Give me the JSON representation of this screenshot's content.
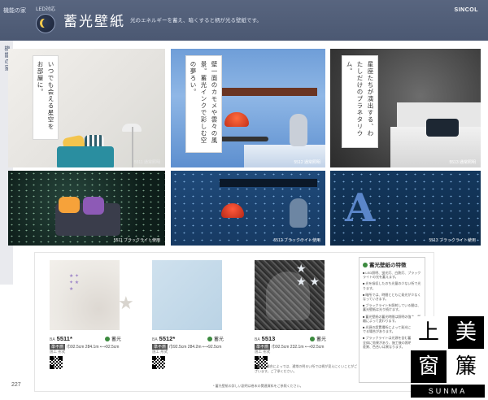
{
  "header": {
    "corner_label": "機能の家",
    "led_label": "LED対応",
    "title": "蓄光壁紙",
    "tagline": "光のエネルギーを蓄え、暗くすると柄が光る壁紙です。",
    "brand": "SINCOL"
  },
  "side_tab": "機能の家",
  "photos": {
    "p1": {
      "text": "いつでも会える星空をお部屋に。",
      "caption": "5511 通常照明"
    },
    "p2": {
      "text": "壁一面のカモメや雲々の風景。蓄光インクで彩しむ空の夢ろい。",
      "caption": "5512 通常照明"
    },
    "p3": {
      "text": "星座たちが演出する、わたしだけのプラネタリウム。",
      "caption": "5513 通常照明"
    },
    "p4": {
      "caption": "5511 ブラックライト使用"
    },
    "p5": {
      "caption": "5512 ブラックライト使用"
    },
    "p6": {
      "caption": "5513 ブラックライト使用",
      "letter": "A"
    }
  },
  "samples": [
    {
      "prefix": "BA",
      "code": "5511",
      "mark": "*",
      "flag": "蓄光",
      "spec_tag": "準不燃",
      "spec": "巾92.5cm 284.1m ⟷92.5cm",
      "sub": "施工 形式"
    },
    {
      "prefix": "BA",
      "code": "5512",
      "mark": "*",
      "flag": "蓄光",
      "spec_tag": "準不燃",
      "spec": "巾92.5cm 284.2m ⟷92.5cm",
      "sub": "施工 形式"
    },
    {
      "prefix": "BA",
      "code": "5513",
      "mark": "",
      "flag": "蓄光",
      "spec_tag": "準不燃",
      "spec": "巾92.5cm 232.1m ⟷92.5cm",
      "sub": "施工 形式"
    }
  ],
  "samples_note": "* 蓄光の場合によっては、通常の明るい所では柄が見えにくいことがございます。ご了承ください。",
  "features": {
    "title": "蓄光壁紙の特徴",
    "items": [
      "LED照明、蛍光灯、白熱灯、ブラックライトの光を蓄えます。",
      "光を吸収したのち光量の少ない所で光ります。",
      "暗所では、時間とともに発光が少なくなっていきます。",
      "ブラックライトを照射している間は、蓄光壁紙は光り続けます。",
      "蓄光壁紙の蓄光時間は照明の強さ、距離によって変わります。",
      "光源の設置場所によって発光にムラがでる場合があります。",
      "ブラックライトは光源を含む蓄光壁紙全体に効果があり、施工後の照明による差異、色合いは異なります。"
    ]
  },
  "stamp": {
    "c1": "上",
    "c2": "美",
    "c3": "窗",
    "c4": "簾",
    "en": "SUNMA"
  },
  "page_number": "227",
  "footnote": "* 蓄光壁紙の詳しい説明は巻末の関連資料をご参照ください。"
}
